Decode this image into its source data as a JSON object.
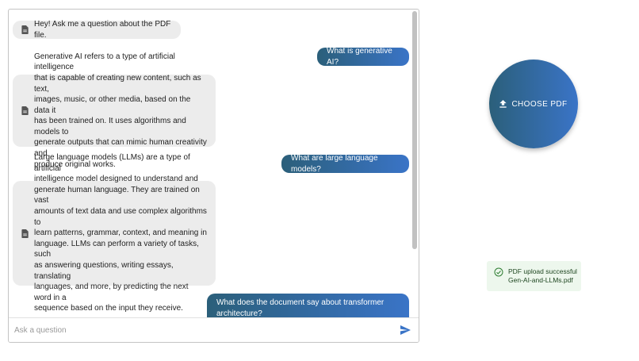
{
  "chat": {
    "messages": [
      {
        "role": "bot",
        "icon": "document-icon",
        "text": "Hey! Ask me a question about the PDF file."
      },
      {
        "role": "user",
        "text": "What is generative AI?"
      },
      {
        "role": "bot",
        "icon": "document-icon",
        "lines": [
          "Generative AI refers to a type of artificial intelligence",
          "that is capable of creating new content, such as text,",
          "images, music, or other media, based on the data it",
          "has been trained on. It uses algorithms and models to",
          "generate outputs that can mimic human creativity and",
          "produce original works."
        ]
      },
      {
        "role": "user",
        "text": "What are large language models?"
      },
      {
        "role": "bot",
        "icon": "document-icon",
        "lines": [
          "Large language models (LLMs) are a type of artificial",
          "intelligence model designed to understand and",
          "generate human language. They are trained on vast",
          "amounts of text data and use complex algorithms to",
          "learn patterns, grammar, context, and meaning in",
          "language. LLMs can perform a variety of tasks, such",
          "as answering questions, writing essays, translating",
          "languages, and more, by predicting the next word in a",
          "sequence based on the input they receive."
        ]
      },
      {
        "role": "user",
        "lines": [
          "What does the document say about transformer",
          "architecture?"
        ]
      }
    ],
    "input": {
      "placeholder": "Ask a question",
      "value": ""
    },
    "send_icon": "send-icon"
  },
  "upload": {
    "button_label": "CHOOSE PDF",
    "button_icon": "upload-icon"
  },
  "toast": {
    "icon": "check-circle-icon",
    "title": "PDF upload successful",
    "filename": "Gen-AI-and-LLMs.pdf"
  },
  "colors": {
    "gradient_start": "#2b5f7a",
    "gradient_end": "#3a74c7",
    "bot_bubble": "#ececec",
    "toast_bg": "#edf7ed",
    "toast_text": "#1e4620"
  }
}
